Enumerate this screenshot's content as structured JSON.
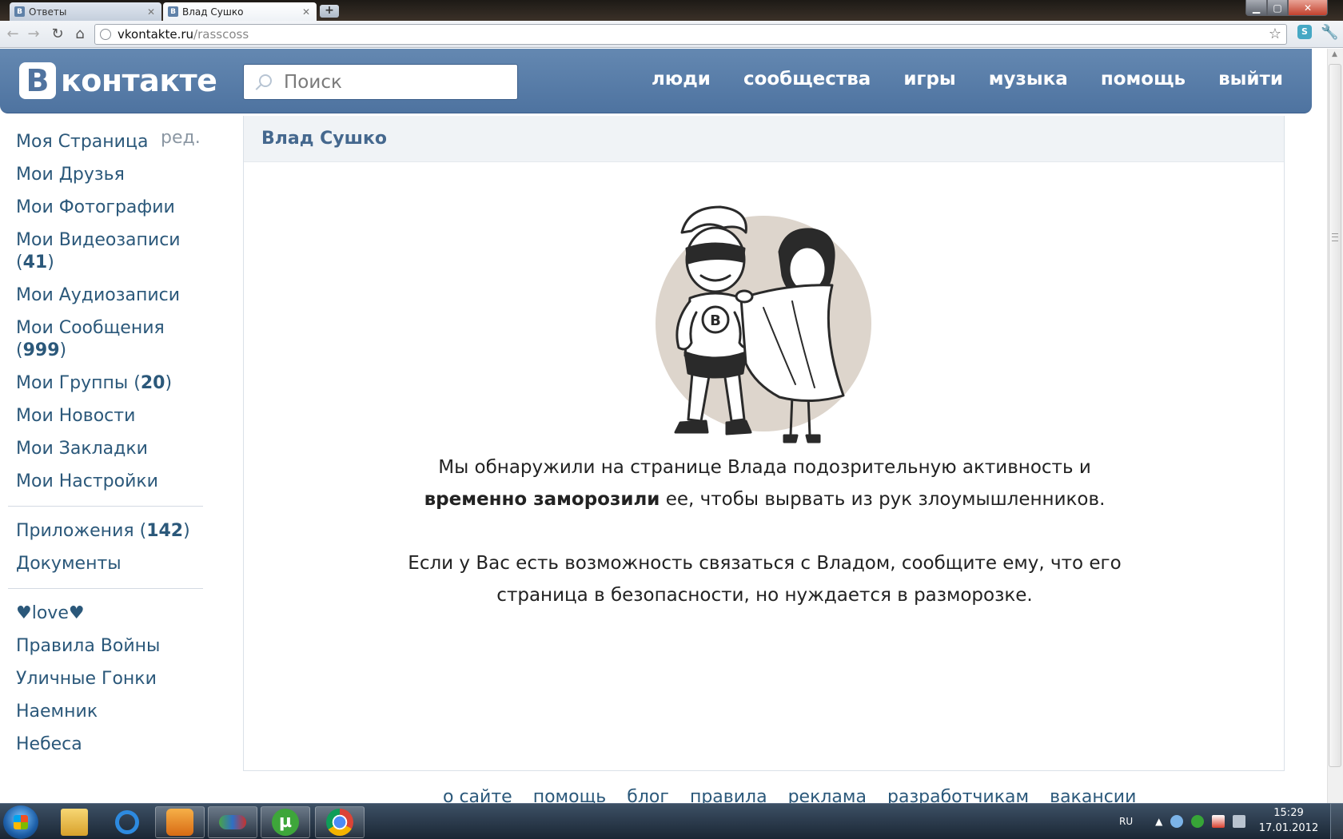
{
  "browser": {
    "tabs": [
      {
        "label": "Ответы",
        "favicon": "В",
        "active": false
      },
      {
        "label": "Влад Сушко",
        "favicon": "В",
        "active": true
      }
    ],
    "new_tab_label": "+",
    "url_host": "vkontakte.ru",
    "url_path": "/rasscoss",
    "extension_label": "S"
  },
  "vk": {
    "logo_letter": "В",
    "logo_text": "контакте",
    "search_placeholder": "Поиск",
    "nav": [
      "люди",
      "сообщества",
      "игры",
      "музыка",
      "помощь",
      "выйти"
    ],
    "accent_color": "#597da3"
  },
  "left_menu": {
    "edit_label": "ред.",
    "group1": [
      {
        "label": "Моя Страница",
        "count": ""
      },
      {
        "label": "Мои Друзья",
        "count": ""
      },
      {
        "label": "Мои Фотографии",
        "count": ""
      },
      {
        "label": "Мои Видеозаписи",
        "count": "41"
      },
      {
        "label": "Мои Аудиозаписи",
        "count": ""
      },
      {
        "label": "Мои Сообщения",
        "count": "999"
      },
      {
        "label": "Мои Группы",
        "count": "20"
      },
      {
        "label": "Мои Новости",
        "count": ""
      },
      {
        "label": "Мои Закладки",
        "count": ""
      },
      {
        "label": "Мои Настройки",
        "count": ""
      }
    ],
    "group2": [
      {
        "label": "Приложения",
        "count": "142"
      },
      {
        "label": "Документы",
        "count": ""
      }
    ],
    "group3": [
      {
        "label": "♥love♥"
      },
      {
        "label": "Правила Войны"
      },
      {
        "label": "Уличные Гонки"
      },
      {
        "label": "Наемник"
      },
      {
        "label": "Небеса"
      }
    ]
  },
  "profile": {
    "name": "Влад Сушко",
    "illustration_badge": "В",
    "message1_line1": "Мы обнаружили на странице Влада подозрительную активность и",
    "message1_bold": "временно заморозили",
    "message1_line2_rest": " ее, чтобы вырвать из рук злоумышленников.",
    "message2_line1": "Если у Вас есть возможность связаться с Владом, сообщите ему, что его",
    "message2_line2": "страница в безопасности, но нуждается в разморозке."
  },
  "footer": [
    "о сайте",
    "помощь",
    "блог",
    "правила",
    "реклама",
    "разработчикам",
    "вакансии"
  ],
  "taskbar": {
    "language": "RU",
    "torrent_letter": "µ",
    "time": "15:29",
    "date": "17.01.2012"
  }
}
